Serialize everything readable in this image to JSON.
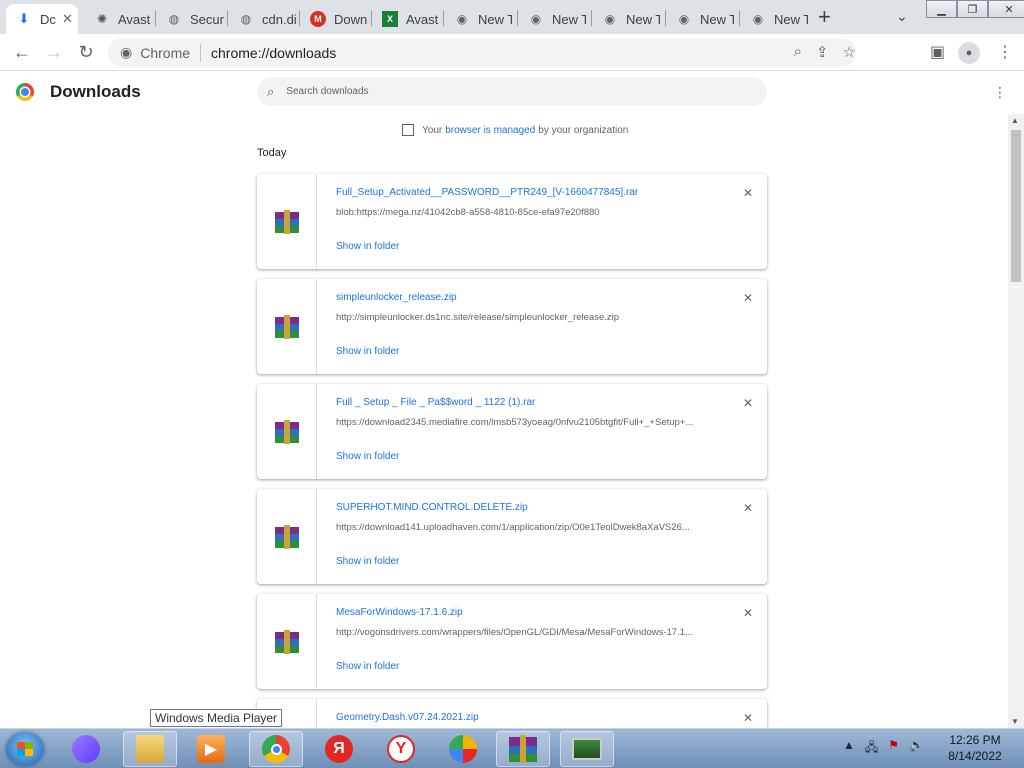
{
  "tabs": [
    {
      "label": "Dc",
      "icon": "download-icon",
      "active": true
    },
    {
      "label": "Avast",
      "icon": "avast-icon"
    },
    {
      "label": "Secur",
      "icon": "globe-icon"
    },
    {
      "label": "cdn.di",
      "icon": "globe-icon"
    },
    {
      "label": "Down",
      "icon": "gmail-icon"
    },
    {
      "label": "Avast",
      "icon": "excel-icon"
    },
    {
      "label": "New T",
      "icon": "chrome-icon"
    },
    {
      "label": "New T",
      "icon": "chrome-icon"
    },
    {
      "label": "New T",
      "icon": "chrome-icon"
    },
    {
      "label": "New T",
      "icon": "chrome-icon"
    },
    {
      "label": "New T",
      "icon": "chrome-icon"
    }
  ],
  "tab_close": "✕",
  "new_tab": "+",
  "omnibox": {
    "chip": "Chrome",
    "url": "chrome://downloads"
  },
  "page": {
    "title": "Downloads",
    "search_placeholder": "Search downloads",
    "managed_prefix": "Your",
    "managed_link": "browser is managed",
    "managed_suffix": "by your organization",
    "section": "Today"
  },
  "downloads": [
    {
      "name": "Full_Setup_Activated__PASSWORD__PTR249_[V-1660477845].rar",
      "url": "blob:https://mega.nz/41042cb8-a558-4810-85ce-efa97e20f880",
      "action": "Show in folder"
    },
    {
      "name": "simpleunlocker_release.zip",
      "url": "http://simpleunlocker.ds1nc.site/release/simpleunlocker_release.zip",
      "action": "Show in folder"
    },
    {
      "name": "Full _ Setup _ File _ Pa$$word _ 1122 (1).rar",
      "url": "https://download2345.mediafire.com/lmsb573yoeag/0nfvu2105btgfit/Full+_+Setup+...",
      "action": "Show in folder"
    },
    {
      "name": "SUPERHOT.MIND.CONTROL.DELETE.zip",
      "url": "https://download141.uploadhaven.com/1/application/zip/O0e1TeolDwek8aXaVS26...",
      "action": "Show in folder"
    },
    {
      "name": "MesaForWindows-17.1.6.zip",
      "url": "http://vogonsdrivers.com/wrappers/files/OpenGL/GDI/Mesa/MesaForWindows-17.1...",
      "action": "Show in folder"
    },
    {
      "name": "Geometry.Dash.v07.24.2021.zip",
      "url": "",
      "action": ""
    }
  ],
  "taskbar": {
    "tooltip": "Windows Media Player",
    "apps": [
      {
        "name": "alice-app",
        "glyph": "",
        "color": "#7b5cff"
      },
      {
        "name": "explorer-app",
        "glyph": "",
        "color": "#e8c15a"
      },
      {
        "name": "media-player-app",
        "glyph": "▶",
        "color": "#f08a24"
      },
      {
        "name": "chrome-app",
        "glyph": "",
        "color": "#4285f4"
      },
      {
        "name": "yandex-browser-app",
        "glyph": "Я",
        "color": "#e52620"
      },
      {
        "name": "yandex-app",
        "glyph": "Y",
        "color": "#e52620"
      },
      {
        "name": "vpn-app",
        "glyph": "",
        "color": "#f4b400"
      },
      {
        "name": "winrar-app",
        "glyph": "",
        "color": "#7b2d8e"
      },
      {
        "name": "monitor-app",
        "glyph": "",
        "color": "#3c7a3c"
      }
    ],
    "time": "12:26 PM",
    "date": "8/14/2022"
  }
}
